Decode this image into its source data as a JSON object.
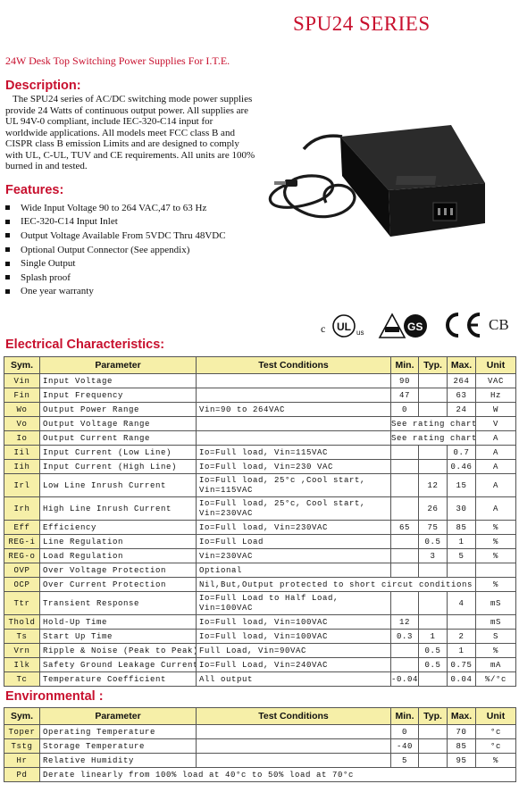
{
  "header": {
    "series_title": "SPU24 SERIES",
    "subtitle": "24W Desk Top Switching Power Supplies For I.T.E."
  },
  "description": {
    "heading": "Description:",
    "text": "The SPU24 series of AC/DC switching mode power supplies provide 24 Watts of continuous output power. All supplies are UL 94V-0 compliant, include IEC-320-C14 input for worldwide applications. All models meet FCC class B and CISPR class B emission Limits and are designed to comply with UL, C-UL, TUV and CE requirements. All units are 100% burned in and tested."
  },
  "features": {
    "heading": "Features:",
    "items": [
      "Wide Input Voltage 90 to 264 VAC,47 to 63 Hz",
      "IEC-320-C14 Input Inlet",
      "Output Voltage Available From 5VDC Thru 48VDC",
      "Optional Output Connector (See appendix)",
      "Single Output",
      "Splash proof",
      "One year warranty"
    ]
  },
  "certifications": {
    "ul_mark": "UL",
    "ul_c": "c",
    "ul_us": "us",
    "cb_label": "CB",
    "icon_names": [
      "cul-us-icon",
      "tuv-gs-icon",
      "ce-mark-icon",
      "cb-icon"
    ]
  },
  "electrical": {
    "heading": "Electrical Characteristics:",
    "columns": [
      "Sym.",
      "Parameter",
      "Test Conditions",
      "Min.",
      "Typ.",
      "Max.",
      "Unit"
    ],
    "rows": [
      {
        "sym": "Vin",
        "param": "Input Voltage",
        "cond": "",
        "min": "90",
        "typ": "",
        "max": "264",
        "unit": "VAC"
      },
      {
        "sym": "Fin",
        "param": "Input Frequency",
        "cond": "",
        "min": "47",
        "typ": "",
        "max": "63",
        "unit": "Hz"
      },
      {
        "sym": "Wo",
        "param": "Output Power Range",
        "cond": "Vin=90 to 264VAC",
        "min": "0",
        "typ": "",
        "max": "24",
        "unit": "W"
      },
      {
        "sym": "Vo",
        "param": "Output Voltage Range",
        "cond": "",
        "span": "See rating chart",
        "unit": "V"
      },
      {
        "sym": "Io",
        "param": "Output Current Range",
        "cond": "",
        "span": "See rating chart",
        "unit": "A"
      },
      {
        "sym": "Iil",
        "param": "Input Current (Low Line)",
        "cond": "Io=Full load, Vin=115VAC",
        "min": "",
        "typ": "",
        "max": "0.7",
        "unit": "A"
      },
      {
        "sym": "Iih",
        "param": "Input Current (High Line)",
        "cond": "Io=Full load, Vin=230 VAC",
        "min": "",
        "typ": "",
        "max": "0.46",
        "unit": "A"
      },
      {
        "sym": "Irl",
        "param": "Low Line Inrush Current",
        "cond": "Io=Full load, 25°c ,Cool start, Vin=115VAC",
        "min": "",
        "typ": "12",
        "max": "15",
        "unit": "A"
      },
      {
        "sym": "Irh",
        "param": "High Line Inrush Current",
        "cond": "Io=Full load, 25°c, Cool start, Vin=230VAC",
        "min": "",
        "typ": "26",
        "max": "30",
        "unit": "A"
      },
      {
        "sym": "Eff",
        "param": "Efficiency",
        "cond": "Io=Full load, Vin=230VAC",
        "min": "65",
        "typ": "75",
        "max": "85",
        "unit": "%"
      },
      {
        "sym": "REG-i",
        "param": "Line Regulation",
        "cond": "Io=Full Load",
        "min": "",
        "typ": "0.5",
        "max": "1",
        "unit": "%"
      },
      {
        "sym": "REG-o",
        "param": "Load Regulation",
        "cond": "Vin=230VAC",
        "min": "",
        "typ": "3",
        "max": "5",
        "unit": "%"
      },
      {
        "sym": "OVP",
        "param": "Over Voltage Protection",
        "cond": "Optional",
        "min": "",
        "typ": "",
        "max": "",
        "unit": ""
      },
      {
        "sym": "OCP",
        "param": "Over Current Protection",
        "cond": "Nil,But,Output protected to short circut conditions",
        "long": true,
        "unit": "%"
      },
      {
        "sym": "Ttr",
        "param": "Transient Response",
        "cond": "Io=Full Load to Half Load, Vin=100VAC",
        "min": "",
        "typ": "",
        "max": "4",
        "unit": "mS"
      },
      {
        "sym": "Thold",
        "param": "Hold-Up Time",
        "cond": "Io=Full load, Vin=100VAC",
        "min": "12",
        "typ": "",
        "max": "",
        "unit": "mS"
      },
      {
        "sym": "Ts",
        "param": "Start Up Time",
        "cond": "Io=Full load, Vin=100VAC",
        "min": "0.3",
        "typ": "1",
        "max": "2",
        "unit": "S"
      },
      {
        "sym": "Vrn",
        "param": "Ripple & Noise (Peak to Peak)",
        "cond": "Full Load, Vin=90VAC",
        "min": "",
        "typ": "0.5",
        "max": "1",
        "unit": "%"
      },
      {
        "sym": "Ilk",
        "param": "Safety Ground Leakage Current",
        "cond": "Io=Full Load, Vin=240VAC",
        "min": "",
        "typ": "0.5",
        "max": "0.75",
        "unit": "mA"
      },
      {
        "sym": "Tc",
        "param": "Temperature Coefficient",
        "cond": "All output",
        "min": "-0.04",
        "typ": "",
        "max": "0.04",
        "unit": "%/°c"
      }
    ]
  },
  "environmental": {
    "heading": "Environmental :",
    "columns": [
      "Sym.",
      "Parameter",
      "Test Conditions",
      "Min.",
      "Typ.",
      "Max.",
      "Unit"
    ],
    "rows": [
      {
        "sym": "Toper",
        "param": "Operating Temperature",
        "cond": "",
        "min": "0",
        "typ": "",
        "max": "70",
        "unit": "°c"
      },
      {
        "sym": "Tstg",
        "param": "Storage Temperature",
        "cond": "",
        "min": "-40",
        "typ": "",
        "max": "85",
        "unit": "°c"
      },
      {
        "sym": "Hr",
        "param": "Relative Humidity",
        "cond": "",
        "min": "5",
        "typ": "",
        "max": "95",
        "unit": "%"
      },
      {
        "sym": "Pd",
        "param": "Derate linearly from 100% load at 40°c to 50% load at 70°c",
        "full": true
      }
    ]
  },
  "colors": {
    "heading_red": "#c8102e",
    "header_fill": "#f6efa8"
  }
}
